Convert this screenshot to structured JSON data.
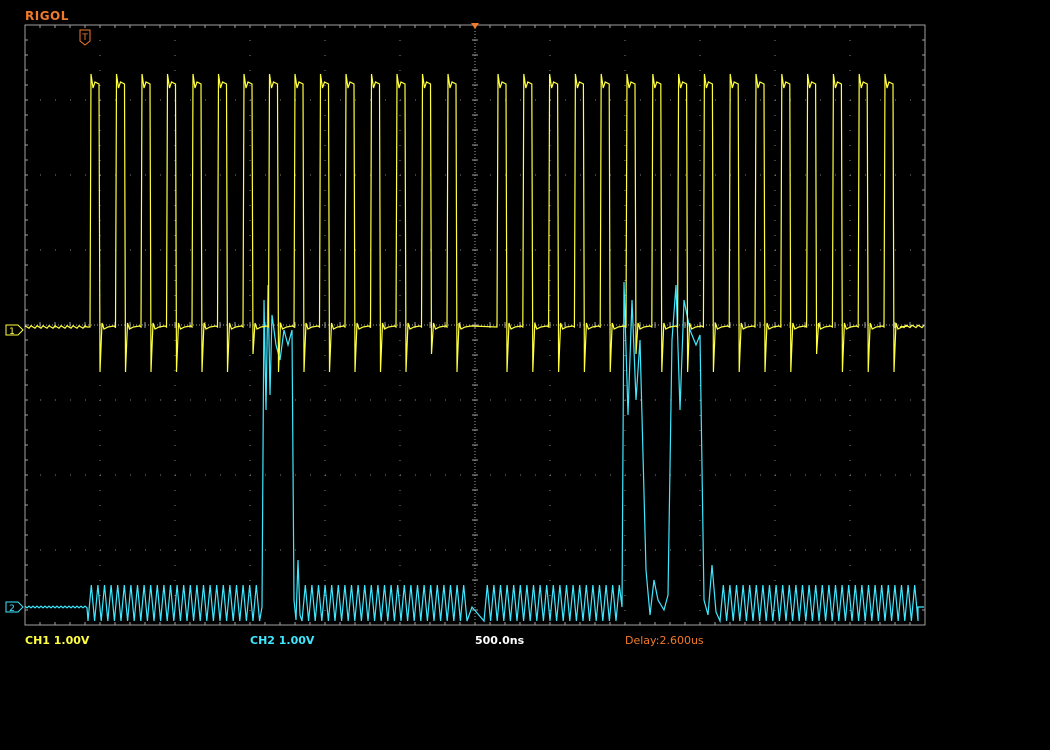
{
  "brand": "RIGOL",
  "trigger_marker": "T",
  "channels": [
    {
      "id": "ch1",
      "marker": "1",
      "label": "CH1",
      "scale": "1.00V",
      "color": "#ffff40"
    },
    {
      "id": "ch2",
      "marker": "2",
      "label": "CH2",
      "scale": "1.00V",
      "color": "#40e8ff"
    }
  ],
  "status": {
    "ch1": "CH1 1.00V",
    "ch2": "CH2 1.00V",
    "timebase": "500.0ns",
    "delay": "Delay:2.600us"
  },
  "colors": {
    "brand": "#f07a2a",
    "grid": "#a0a0a0",
    "ch1": "#ffff40",
    "ch2": "#40e8ff"
  }
}
